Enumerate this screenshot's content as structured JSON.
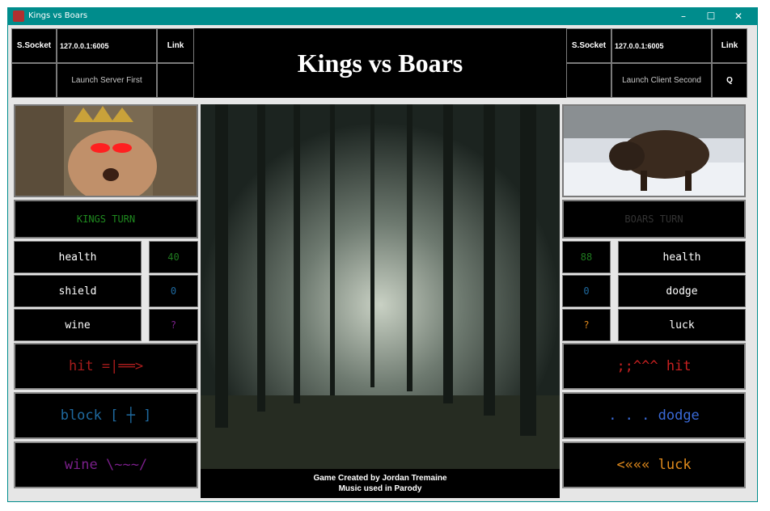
{
  "window": {
    "title": "Kings vs Boars",
    "minimize": "–",
    "maximize": "☐",
    "close": "✕"
  },
  "header": {
    "title": "Kings vs Boars",
    "left": {
      "socket_label": "S.Socket",
      "address": "127.0.0.1:6005",
      "link_label": "Link",
      "launch_label": "Launch Server First"
    },
    "right": {
      "socket_label": "S.Socket",
      "address": "127.0.0.1:6005",
      "link_label": "Link",
      "launch_label": "Launch Client Second",
      "quit_label": "Q"
    }
  },
  "king": {
    "turn_label": "KINGS TURN",
    "stats": [
      {
        "name": "health",
        "value": "40",
        "color": "#1f7a1f"
      },
      {
        "name": "shield",
        "value": "0",
        "color": "#1f6aa0"
      },
      {
        "name": "wine",
        "value": "?",
        "color": "#7a1f8a"
      }
    ],
    "actions": [
      {
        "label": "hit  =|══>",
        "color": "#a81c1c"
      },
      {
        "label": "block [ ┼ ]",
        "color": "#1f6aa0"
      },
      {
        "label": "wine  \\~~~/",
        "color": "#7a1f8a"
      }
    ]
  },
  "boar": {
    "turn_label": "BOARS TURN",
    "stats": [
      {
        "name": "health",
        "value": "88",
        "color": "#1f7a1f"
      },
      {
        "name": "dodge",
        "value": "0",
        "color": "#1f6aa0"
      },
      {
        "name": "luck",
        "value": "?",
        "color": "#e08a1c"
      }
    ],
    "actions": [
      {
        "label": ";;^^^ hit",
        "color": "#c82020"
      },
      {
        "label": ". . . dodge",
        "color": "#3a6ad8"
      },
      {
        "label": "<««« luck",
        "color": "#e08a1c"
      }
    ]
  },
  "credits": {
    "line1": "Game Created by Jordan Tremaine",
    "line2": "Music used in Parody"
  },
  "colors": {
    "turn_active": "#1f8a1f",
    "turn_inactive": "#333333",
    "titlebar": "#008c8c"
  }
}
